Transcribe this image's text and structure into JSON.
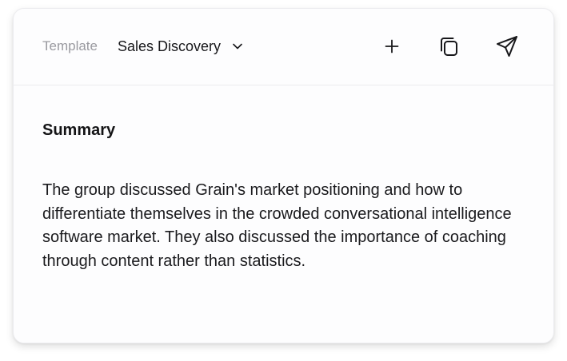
{
  "header": {
    "template_label": "Template",
    "template_value": "Sales Discovery",
    "icons": {
      "dropdown": "chevron-down-icon",
      "add": "plus-icon",
      "copy": "copy-icon",
      "send": "send-icon"
    }
  },
  "summary": {
    "heading": "Summary",
    "body": "The group discussed Grain's market positioning and how to differentiate themselves in the crowded conversational intelligence software market. They also discussed the importance of coaching through content rather than statistics."
  },
  "colors": {
    "text_primary": "#17171a",
    "text_muted": "#9a9aa0",
    "divider": "#ececef",
    "card_background": "#fdfdfe"
  }
}
